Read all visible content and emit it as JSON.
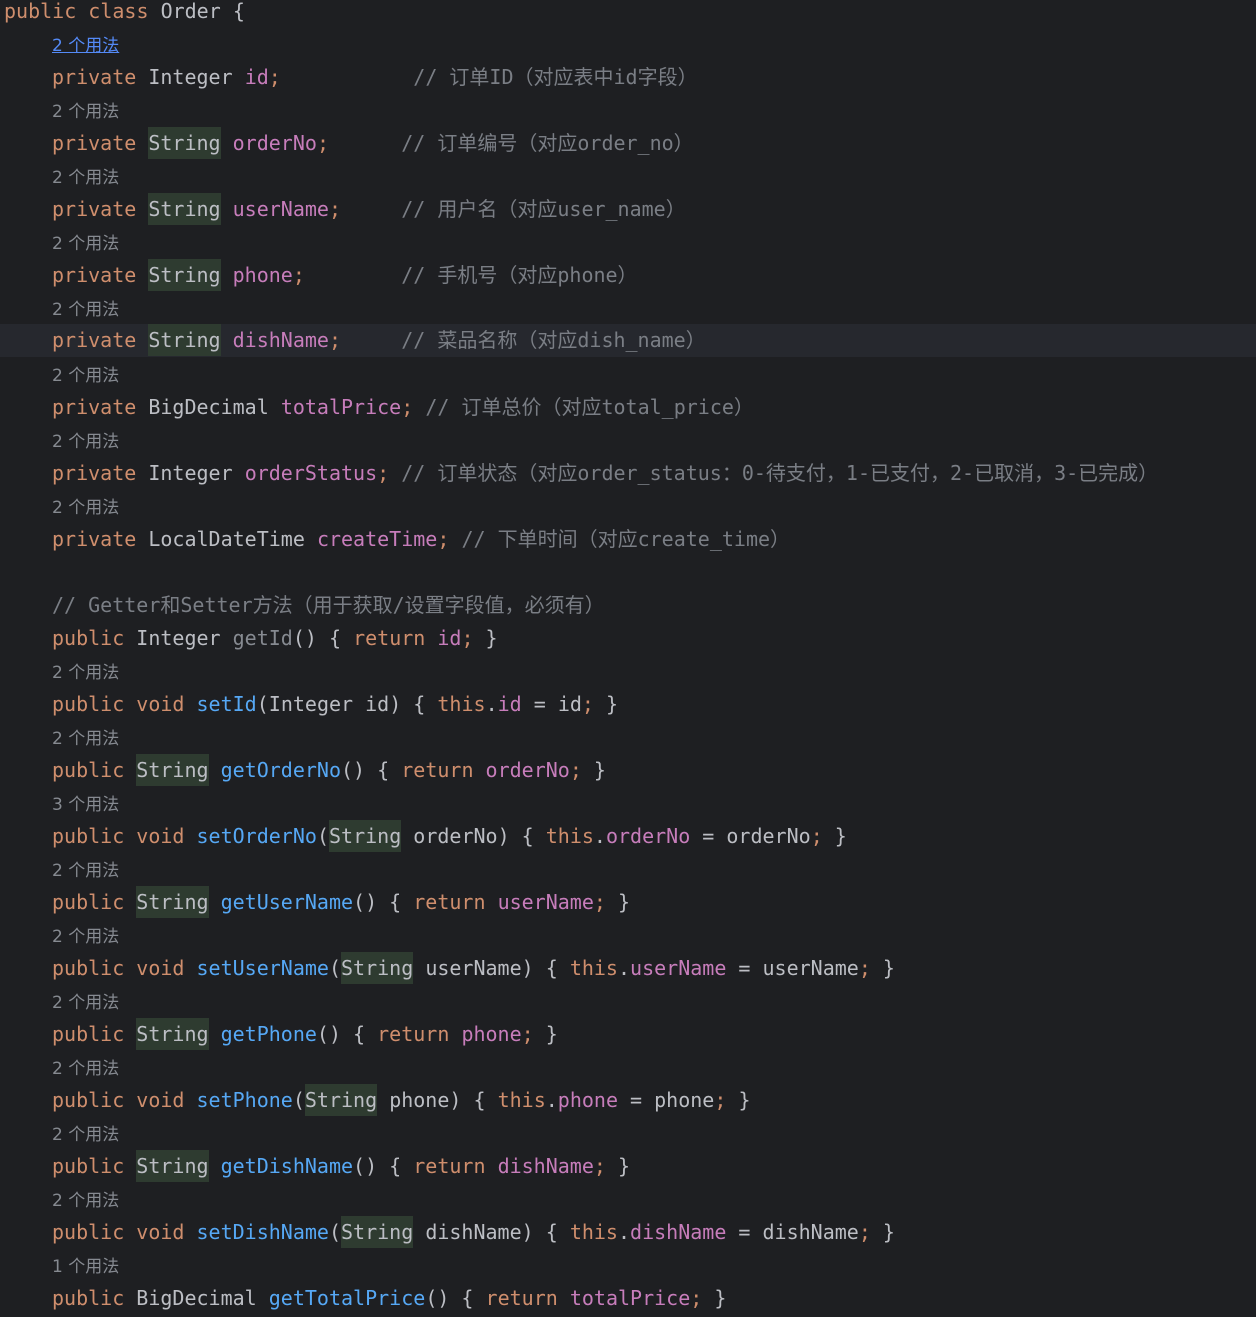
{
  "header": {
    "kw_public": "public",
    "kw_class": "class",
    "class_name": "Order",
    "brace": "{"
  },
  "hints": {
    "h1": "2 个用法",
    "h2": "2 个用法",
    "h3": "2 个用法",
    "h4": "2 个用法",
    "h5": "2 个用法",
    "h6": "2 个用法",
    "h7": "2 个用法",
    "h8": "2 个用法",
    "h9": "2 个用法",
    "h10": "2 个用法",
    "h11": "3 个用法",
    "h12": "2 个用法",
    "h13": "2 个用法",
    "h14": "2 个用法",
    "h15": "2 个用法",
    "h16": "2 个用法",
    "h17": "2 个用法",
    "h18": "1 个用法"
  },
  "fields": [
    {
      "mod": "private",
      "type": "Integer",
      "name": "id",
      "semi": ";",
      "pad": "           ",
      "comment": "// 订单ID（对应表中id字段）"
    },
    {
      "mod": "private",
      "type": "String",
      "name": "orderNo",
      "semi": ";",
      "pad": "      ",
      "comment": "// 订单编号（对应order_no）"
    },
    {
      "mod": "private",
      "type": "String",
      "name": "userName",
      "semi": ";",
      "pad": "     ",
      "comment": "// 用户名（对应user_name）"
    },
    {
      "mod": "private",
      "type": "String",
      "name": "phone",
      "semi": ";",
      "pad": "        ",
      "comment": "// 手机号（对应phone）"
    },
    {
      "mod": "private",
      "type": "String",
      "name": "dishName",
      "semi": ";",
      "pad": "     ",
      "comment": "// 菜品名称（对应dish_name）"
    },
    {
      "mod": "private",
      "type": "BigDecimal",
      "name": "totalPrice",
      "semi": ";",
      "pad": " ",
      "comment": "// 订单总价（对应total_price）"
    },
    {
      "mod": "private",
      "type": "Integer",
      "name": "orderStatus",
      "semi": ";",
      "pad": " ",
      "comment": "// 订单状态（对应order_status：0-待支付，1-已支付，2-已取消，3-已完成）"
    },
    {
      "mod": "private",
      "type": "LocalDateTime",
      "name": "createTime",
      "semi": ";",
      "pad": " ",
      "comment": "// 下单时间（对应create_time）"
    }
  ],
  "section_comment": "// Getter和Setter方法（用于获取/设置字段值，必须有）",
  "code": {
    "kw_public": "public",
    "kw_void": "void",
    "kw_return": "return",
    "kw_this": "this",
    "t_integer": "Integer",
    "t_string": "String",
    "t_bigdecimal": "BigDecimal",
    "m_getId": "getId",
    "m_setId": "setId",
    "m_getOrderNo": "getOrderNo",
    "m_setOrderNo": "setOrderNo",
    "m_getUserName": "getUserName",
    "m_setUserName": "setUserName",
    "m_getPhone": "getPhone",
    "m_setPhone": "setPhone",
    "m_getDishName": "getDishName",
    "m_setDishName": "setDishName",
    "m_getTotalPrice": "getTotalPrice",
    "f_id": "id",
    "f_orderNo": "orderNo",
    "f_userName": "userName",
    "f_phone": "phone",
    "f_dishName": "dishName",
    "f_totalPrice": "totalPrice"
  }
}
